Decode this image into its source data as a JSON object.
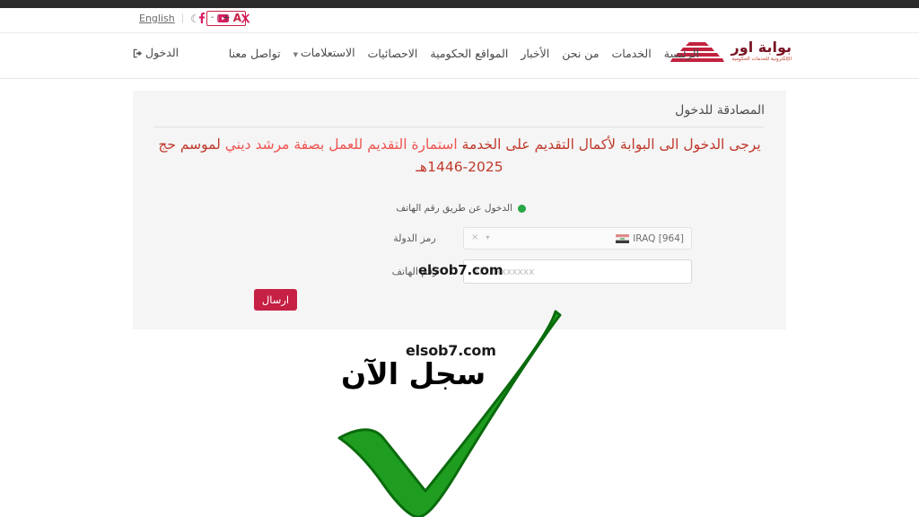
{
  "utility_bar": {
    "social": [
      {
        "name": "x-twitter-icon",
        "label": "X"
      },
      {
        "name": "youtube-icon",
        "label": "YouTube"
      },
      {
        "name": "facebook-icon",
        "label": "f"
      }
    ],
    "font_size": {
      "decrease": "-",
      "separator": "|",
      "increase": "+",
      "letter": "A"
    },
    "dark_mode_icon": "☾",
    "separator": "|",
    "language": "English"
  },
  "header": {
    "logo": {
      "title": "بوابة اور",
      "subtitle": "الإلكترونية للخدمات الحكومية"
    },
    "nav_items": [
      {
        "label": "الرئيسة",
        "has_caret": false
      },
      {
        "label": "الخدمات",
        "has_caret": false
      },
      {
        "label": "من نحن",
        "has_caret": false
      },
      {
        "label": "الأخبار",
        "has_caret": false
      },
      {
        "label": "المواقع الحكومية",
        "has_caret": false
      },
      {
        "label": "الاحصائيات",
        "has_caret": false
      },
      {
        "label": "الاستعلامات",
        "has_caret": true
      },
      {
        "label": "تواصل معنا",
        "has_caret": false
      }
    ],
    "login_link": "الدخول"
  },
  "card": {
    "title": "المصادقة للدخول",
    "notice": {
      "prefix": "يرجى الدخول الى البوابة لأكمال التقديم على الخدمة ",
      "link": "استمارة التقديم للعمل بصفة مرشد ديني",
      "suffix": " لموسم حج 2025-1446هـ"
    },
    "radio": {
      "label": "الدخول عن طريق رقم الهاتف",
      "selected": true,
      "color": "#28a745"
    },
    "fields": [
      {
        "name": "country-code",
        "label": "رمز الدولة",
        "value": "IRAQ [964]",
        "flag": "iraq-flag-icon",
        "clear_icon": "×",
        "caret_icon": "▾"
      },
      {
        "name": "phone-number",
        "label": "رقم الهاتف",
        "value": "",
        "placeholder": "07xxxxxxxxx"
      }
    ],
    "submit_label": "ارسال"
  },
  "overlay": {
    "watermark_field": "elsob7.com",
    "watermark_big": "elsob7.com",
    "cta_text": "سجل الآن",
    "checkmark_color": "#1f9d20",
    "checkmark_outline": "#0a6b0d"
  },
  "colors": {
    "brand_red": "#c62044",
    "logo_maroon": "#7a1524",
    "notice_red": "#c0392b",
    "link_red": "#ef5350",
    "card_bg": "#f5f5f5",
    "page_bg": "#ffffff",
    "letterbox": "#2b2b2b",
    "green": "#28a745"
  }
}
